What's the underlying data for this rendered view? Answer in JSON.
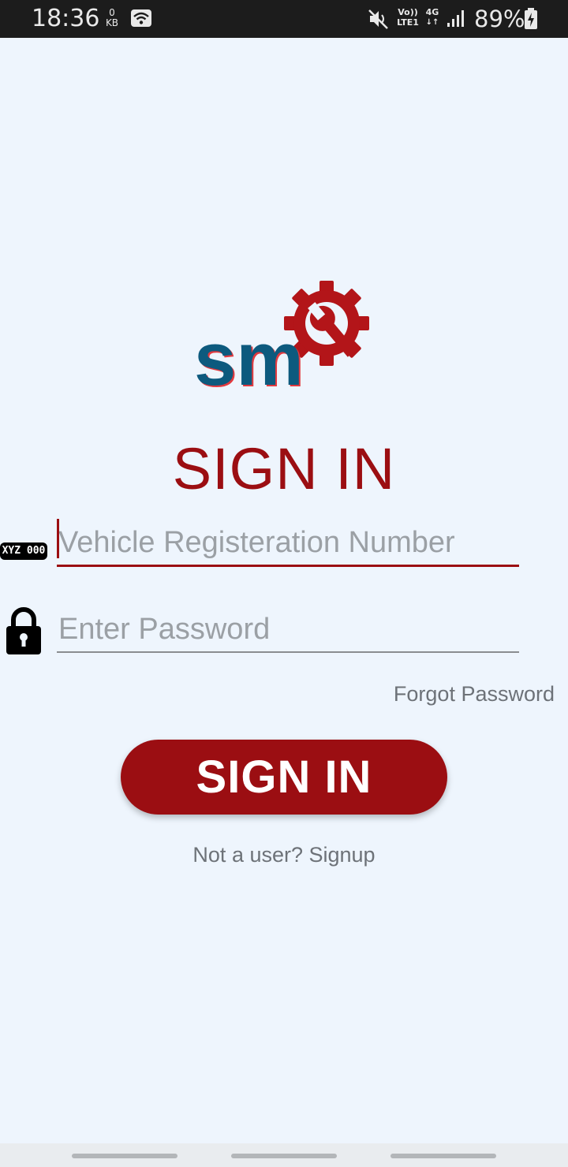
{
  "status_bar": {
    "time": "18:36",
    "data_rate_value": "0",
    "data_rate_unit": "KB",
    "volte_top": "Vo))",
    "volte_bottom": "LTE1",
    "network": "4G",
    "network_arrows": "↓↑",
    "battery": "89%"
  },
  "login": {
    "title": "SIGN IN",
    "reg_icon_text": "XYZ 000",
    "reg_placeholder": "Vehicle Registeration Number",
    "password_placeholder": "Enter Password",
    "forgot_password": "Forgot Password",
    "signin_button": "SIGN IN",
    "signup_link": "Not a user? Signup"
  },
  "logo": {
    "text": "sm",
    "colors": {
      "text": "#0d5a7e",
      "gear": "#b31519"
    }
  },
  "colors": {
    "accent": "#9b0e12",
    "background": "#eef5fd"
  },
  "icons": [
    "wifi-icon",
    "mute-icon",
    "signal-icon",
    "battery-icon",
    "registration-plate-icon",
    "lock-icon"
  ]
}
